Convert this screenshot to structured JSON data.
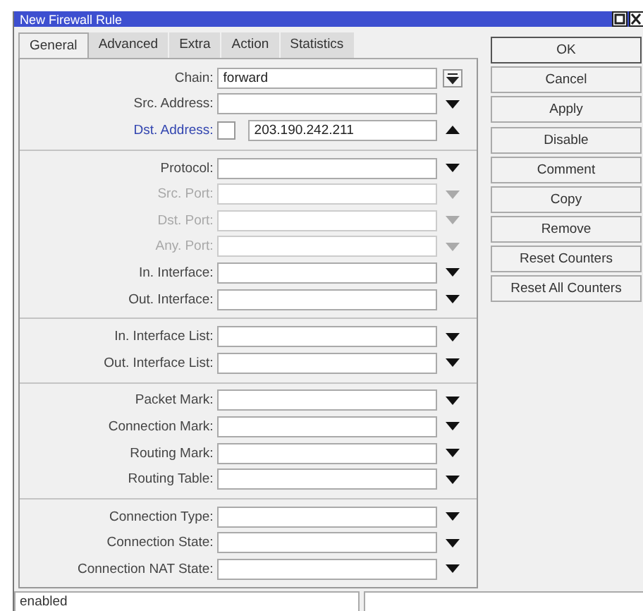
{
  "window": {
    "title": "New Firewall Rule"
  },
  "tabs": [
    {
      "label": "General",
      "selected": true
    },
    {
      "label": "Advanced",
      "selected": false
    },
    {
      "label": "Extra",
      "selected": false
    },
    {
      "label": "Action",
      "selected": false
    },
    {
      "label": "Statistics",
      "selected": false
    }
  ],
  "field_groups": [
    [
      {
        "label": "Chain:",
        "value": "forward",
        "kind": "combo",
        "disabled": false,
        "highlighted": false
      },
      {
        "label": "Src. Address:",
        "kind": "dropdown",
        "disabled": false,
        "highlighted": false
      },
      {
        "label": "Dst. Address:",
        "value": "203.190.242.211",
        "kind": "collapsible",
        "disabled": false,
        "highlighted": true,
        "negate": false
      }
    ],
    [
      {
        "label": "Protocol:",
        "kind": "dropdown",
        "disabled": false,
        "highlighted": false
      },
      {
        "label": "Src. Port:",
        "kind": "dropdown",
        "disabled": true,
        "highlighted": false
      },
      {
        "label": "Dst. Port:",
        "kind": "dropdown",
        "disabled": true,
        "highlighted": false
      },
      {
        "label": "Any. Port:",
        "kind": "dropdown",
        "disabled": true,
        "highlighted": false
      },
      {
        "label": "In. Interface:",
        "kind": "dropdown",
        "disabled": false,
        "highlighted": false
      },
      {
        "label": "Out. Interface:",
        "kind": "dropdown",
        "disabled": false,
        "highlighted": false
      }
    ],
    [
      {
        "label": "In. Interface List:",
        "kind": "dropdown",
        "disabled": false,
        "highlighted": false
      },
      {
        "label": "Out. Interface List:",
        "kind": "dropdown",
        "disabled": false,
        "highlighted": false
      }
    ],
    [
      {
        "label": "Packet Mark:",
        "kind": "dropdown",
        "disabled": false,
        "highlighted": false
      },
      {
        "label": "Connection Mark:",
        "kind": "dropdown",
        "disabled": false,
        "highlighted": false
      },
      {
        "label": "Routing Mark:",
        "kind": "dropdown",
        "disabled": false,
        "highlighted": false
      },
      {
        "label": "Routing Table:",
        "kind": "dropdown",
        "disabled": false,
        "highlighted": false
      }
    ],
    [
      {
        "label": "Connection Type:",
        "kind": "dropdown",
        "disabled": false,
        "highlighted": false
      },
      {
        "label": "Connection State:",
        "kind": "dropdown",
        "disabled": false,
        "highlighted": false
      },
      {
        "label": "Connection NAT State:",
        "kind": "dropdown",
        "disabled": false,
        "highlighted": false
      }
    ]
  ],
  "button_groups": [
    [
      "OK",
      "Cancel",
      "Apply"
    ],
    [
      "Disable",
      "Comment",
      "Copy",
      "Remove",
      "Reset Counters",
      "Reset All Counters"
    ]
  ],
  "status_bar": {
    "state": "enabled"
  }
}
